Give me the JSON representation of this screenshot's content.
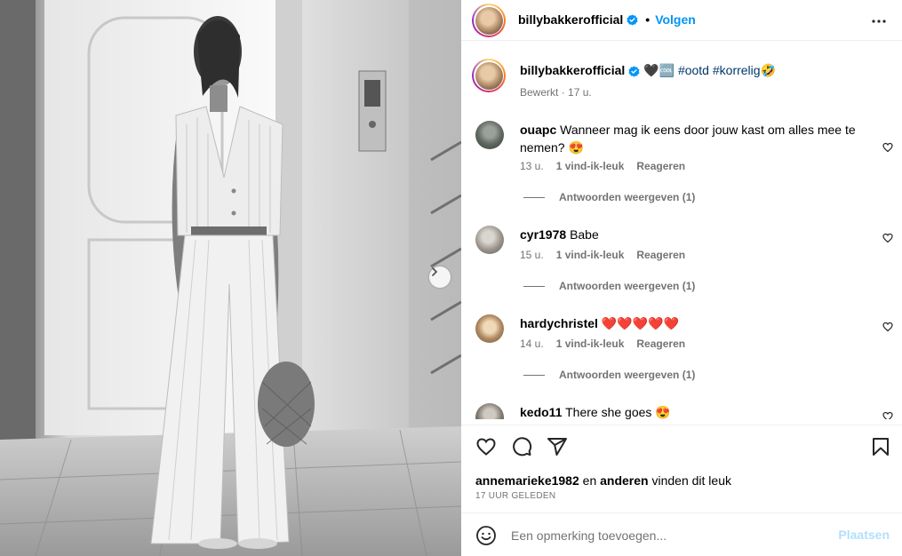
{
  "header": {
    "username": "billybakkerofficial",
    "separator": "•",
    "follow_label": "Volgen"
  },
  "caption": {
    "username": "billybakkerofficial",
    "text_emoji": "🖤🆒",
    "hashtags": [
      "#ootd",
      "#korrelig🤣"
    ],
    "edited": "Bewerkt",
    "separator": " · ",
    "age": "17 u."
  },
  "comments": [
    {
      "username": "ouapc",
      "text": "Wanneer mag ik eens door jouw kast om alles mee te nemen? 😍",
      "age": "13 u.",
      "likes": "1 vind-ik-leuk",
      "reply_label": "Reageren",
      "view_replies": "Antwoorden weergeven (1)"
    },
    {
      "username": "cyr1978",
      "text": "Babe",
      "age": "15 u.",
      "likes": "1 vind-ik-leuk",
      "reply_label": "Reageren",
      "view_replies": "Antwoorden weergeven (1)"
    },
    {
      "username": "hardychristel",
      "text": "❤️❤️❤️❤️❤️",
      "age": "14 u.",
      "likes": "1 vind-ik-leuk",
      "reply_label": "Reageren",
      "view_replies": "Antwoorden weergeven (1)"
    },
    {
      "username": "kedo11",
      "text": "There she goes 😍"
    }
  ],
  "actions": {
    "liked_by_user": "annemarieke1982",
    "liked_by_connector": " en ",
    "liked_by_others": "anderen",
    "liked_by_suffix": " vinden dit leuk",
    "timestamp": "17 UUR GELEDEN"
  },
  "comment_bar": {
    "placeholder": "Een opmerking toevoegen...",
    "post_label": "Plaatsen"
  },
  "icons": {
    "more": "more-horizontal-icon",
    "verified": "verified-badge-icon",
    "like": "heart-icon",
    "comment": "comment-bubble-icon",
    "share": "paper-plane-icon",
    "save": "bookmark-icon",
    "emoji": "emoji-smiley-icon",
    "next": "chevron-right-icon"
  },
  "colors": {
    "accent": "#0095f6",
    "hashtag": "#00376b",
    "secondary_text": "#737373",
    "post_disabled": "#b2dffc",
    "verified": "#0095f6"
  }
}
